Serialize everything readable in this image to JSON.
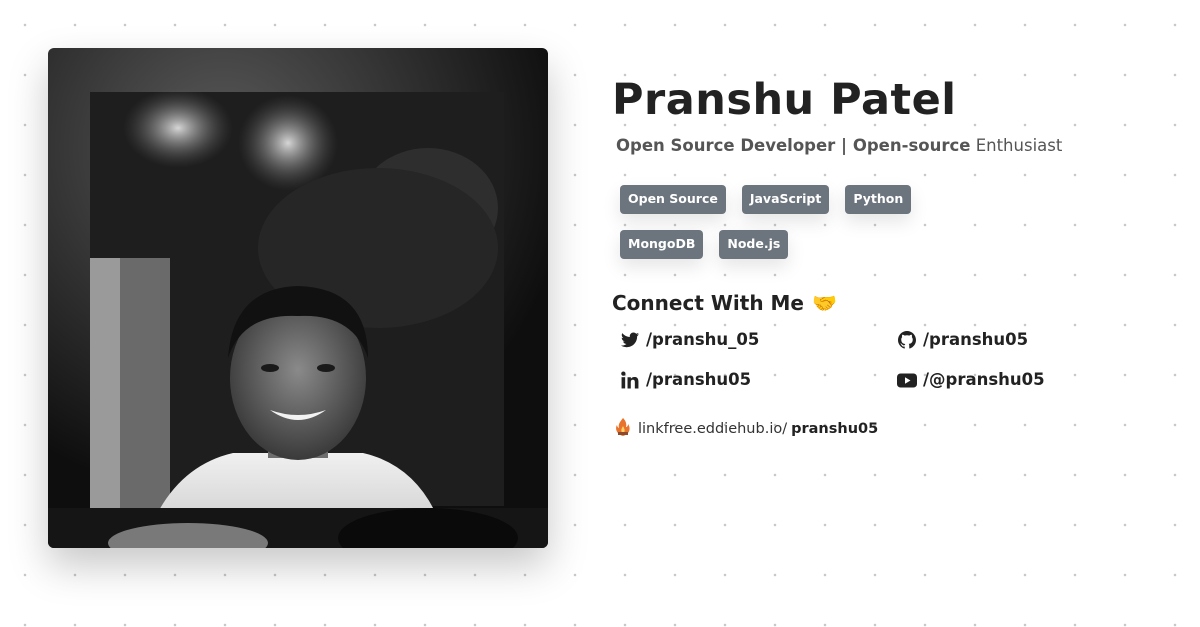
{
  "profile": {
    "name": "Pranshu Patel",
    "tagline_part1": "Open Source Developer | Open-source",
    "tagline_part2": "Enthusiast",
    "photo_alt": "profile-photo"
  },
  "tags": [
    "Open Source",
    "JavaScript",
    "Python",
    "MongoDB",
    "Node.js"
  ],
  "connect": {
    "title": "Connect With Me",
    "emoji": "🤝",
    "links": [
      {
        "icon": "twitter-icon",
        "handle": "/pranshu_05"
      },
      {
        "icon": "github-icon",
        "handle": "/pranshu05"
      },
      {
        "icon": "linkedin-icon",
        "handle": "/pranshu05"
      },
      {
        "icon": "youtube-icon",
        "handle": "/@pranshu05"
      }
    ]
  },
  "linkfree": {
    "prefix": "linkfree.eddiehub.io/",
    "username": "pranshu05",
    "icon": "linkfree-logo-icon"
  },
  "colors": {
    "tag_bg": "#6c757d",
    "text_dark": "#222222",
    "text_muted": "#555555"
  }
}
